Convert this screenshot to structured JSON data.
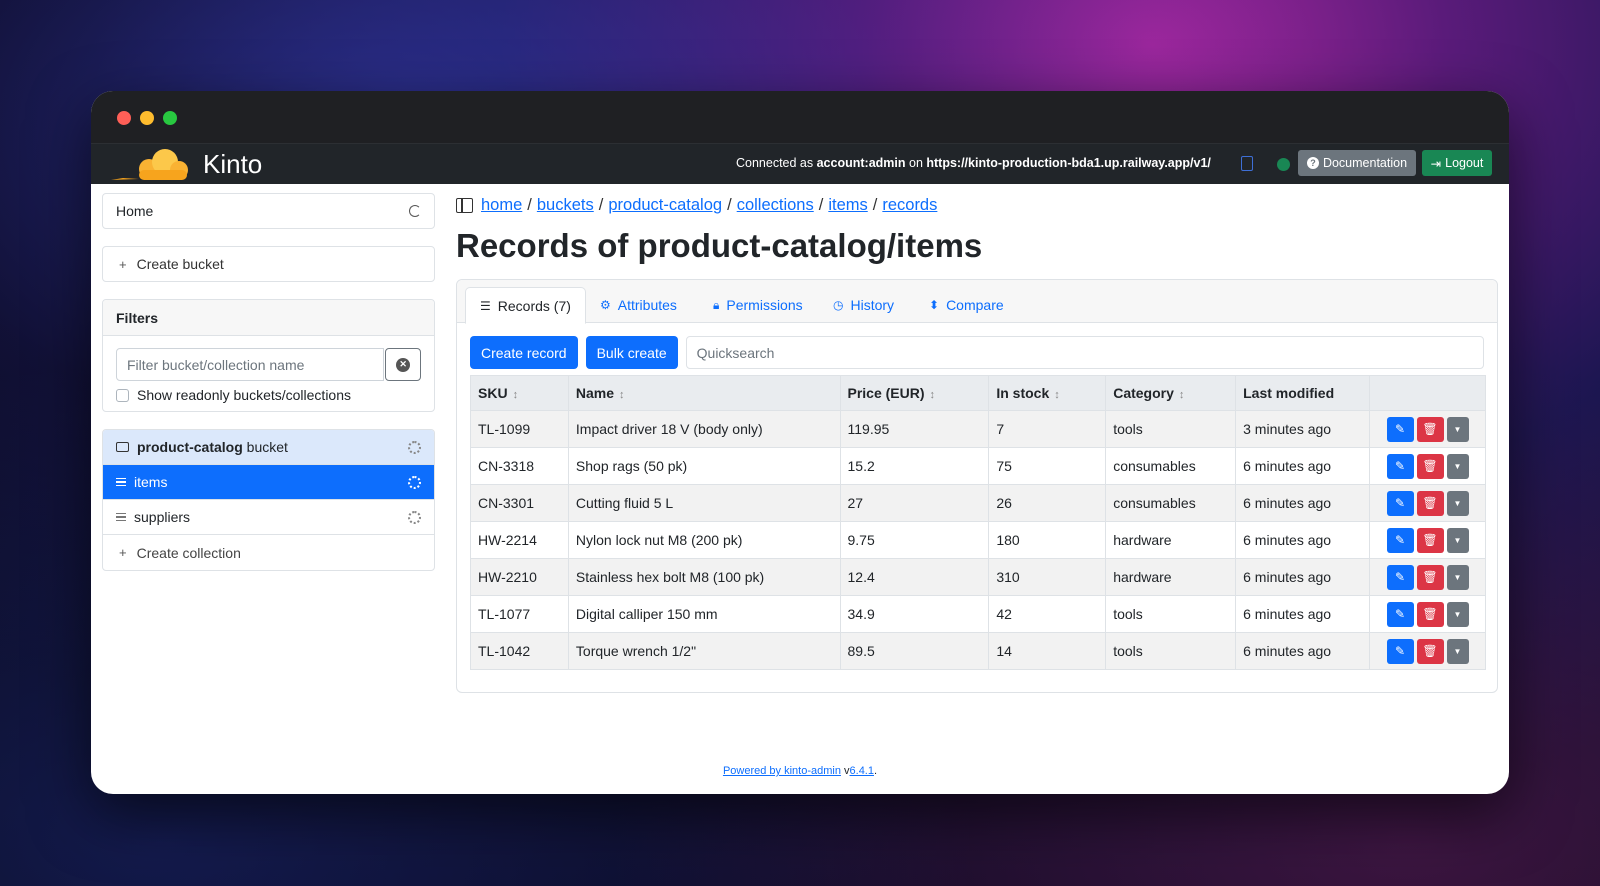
{
  "navbar": {
    "brand": "Kinto",
    "connected_prefix": "Connected as ",
    "account": "account:admin",
    "on_text": " on ",
    "server_url": "https://kinto-production-bda1.up.railway.app/v1/",
    "documentation_label": "Documentation",
    "logout_label": "Logout"
  },
  "sidebar": {
    "home_label": "Home",
    "create_bucket_label": "Create bucket",
    "filters_title": "Filters",
    "filter_placeholder": "Filter bucket/collection name",
    "show_readonly_label": "Show readonly buckets/collections",
    "bucket_name": "product-catalog",
    "bucket_suffix": " bucket",
    "collections": [
      "items",
      "suppliers"
    ],
    "create_collection_label": "Create collection"
  },
  "breadcrumb": [
    "home",
    "buckets",
    "product-catalog",
    "collections",
    "items",
    "records"
  ],
  "title_prefix": "Records of ",
  "title_path": "product-catalog/items",
  "tabs": [
    "Records (7)",
    "Attributes",
    "Permissions",
    "History",
    "Compare"
  ],
  "toolbar": {
    "create_record": "Create record",
    "bulk_create": "Bulk create",
    "quicksearch_placeholder": "Quicksearch"
  },
  "table": {
    "headers": [
      "SKU",
      "Name",
      "Price (EUR)",
      "In stock",
      "Category",
      "Last modified"
    ],
    "rows": [
      [
        "TL-1099",
        "Impact driver 18 V (body only)",
        "119.95",
        "7",
        "tools",
        "3 minutes ago"
      ],
      [
        "CN-3318",
        "Shop rags (50 pk)",
        "15.2",
        "75",
        "consumables",
        "6 minutes ago"
      ],
      [
        "CN-3301",
        "Cutting fluid 5 L",
        "27",
        "26",
        "consumables",
        "6 minutes ago"
      ],
      [
        "HW-2214",
        "Nylon lock nut M8 (200 pk)",
        "9.75",
        "180",
        "hardware",
        "6 minutes ago"
      ],
      [
        "HW-2210",
        "Stainless hex bolt M8 (100 pk)",
        "12.4",
        "310",
        "hardware",
        "6 minutes ago"
      ],
      [
        "TL-1077",
        "Digital calliper 150 mm",
        "34.9",
        "42",
        "tools",
        "6 minutes ago"
      ],
      [
        "TL-1042",
        "Torque wrench 1/2\"",
        "89.5",
        "14",
        "tools",
        "6 minutes ago"
      ]
    ]
  },
  "footer": {
    "powered_by": "Powered by kinto-admin",
    "v_prefix": " v",
    "version": "6.4.1",
    "dot": "."
  },
  "colors": {
    "primary": "#0d6efd",
    "danger": "#dc3545",
    "secondary": "#6c757d",
    "success": "#198754",
    "navbar": "#212529"
  }
}
